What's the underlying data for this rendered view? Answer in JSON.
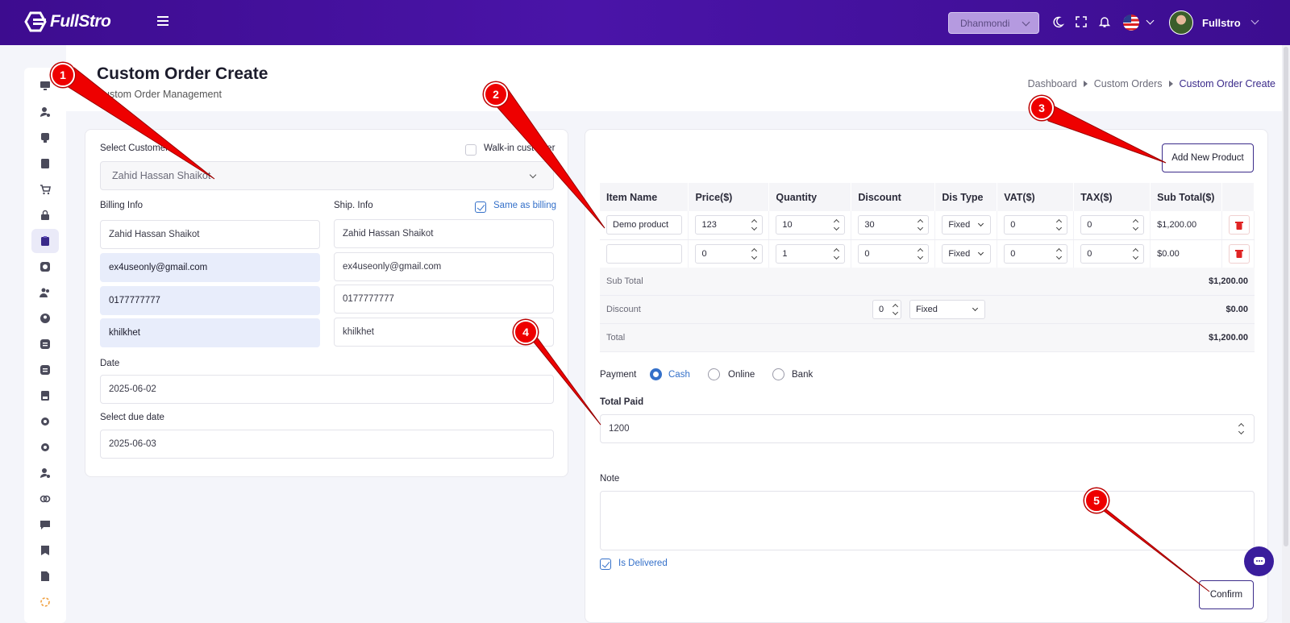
{
  "brand": {
    "name": "FullStro"
  },
  "topbar": {
    "branch": "Dhanmondi",
    "user_name": "Fullstro"
  },
  "page": {
    "title": "Custom Order Create",
    "subtitle": "Custom Order Management"
  },
  "breadcrumb": {
    "items": [
      "Dashboard",
      "Custom Orders"
    ],
    "current": "Custom Order Create"
  },
  "customer": {
    "label": "Select Customer",
    "walkin_label": "Walk-in customer",
    "selected": "Zahid Hassan Shaikot"
  },
  "billing": {
    "label": "Billing Info",
    "name": "Zahid Hassan Shaikot",
    "email": "ex4useonly@gmail.com",
    "phone": "0177777777",
    "address": "khilkhet"
  },
  "shipping": {
    "label": "Ship. Info",
    "same_label": "Same as billing",
    "name": "Zahid Hassan Shaikot",
    "email": "ex4useonly@gmail.com",
    "phone": "0177777777",
    "address": "khilkhet"
  },
  "date": {
    "label": "Date",
    "value": "2025-06-02"
  },
  "due_date": {
    "label": "Select due date",
    "value": "2025-06-03"
  },
  "add_product_label": "Add New Product",
  "table": {
    "headers": [
      "Item Name",
      "Price($)",
      "Quantity",
      "Discount",
      "Dis Type",
      "VAT($)",
      "TAX($)",
      "Sub Total($)"
    ],
    "rows": [
      {
        "item": "Demo product",
        "price": "123",
        "qty": "10",
        "discount": "30",
        "dis_type": "Fixed",
        "vat": "0",
        "tax": "0",
        "subtotal": "$1,200.00"
      },
      {
        "item": "",
        "price": "0",
        "qty": "1",
        "discount": "0",
        "dis_type": "Fixed",
        "vat": "0",
        "tax": "0",
        "subtotal": "$0.00"
      }
    ]
  },
  "summary": {
    "subtotal_label": "Sub Total",
    "subtotal": "$1,200.00",
    "discount_label": "Discount",
    "discount_input": "0",
    "discount_type": "Fixed",
    "discount": "$0.00",
    "total_label": "Total",
    "total": "$1,200.00"
  },
  "payment": {
    "label": "Payment",
    "options": [
      "Cash",
      "Online",
      "Bank"
    ],
    "selected": "Cash"
  },
  "total_paid": {
    "label": "Total Paid",
    "value": "1200"
  },
  "note": {
    "label": "Note",
    "value": ""
  },
  "delivered": {
    "label": "Is Delivered",
    "checked": true
  },
  "confirm_label": "Confirm",
  "callouts": [
    "1",
    "2",
    "3",
    "4",
    "5"
  ],
  "colors": {
    "topbar": "#3d0c8f",
    "accent": "#3470c9",
    "callout": "#e00000",
    "delete": "#e02424"
  }
}
